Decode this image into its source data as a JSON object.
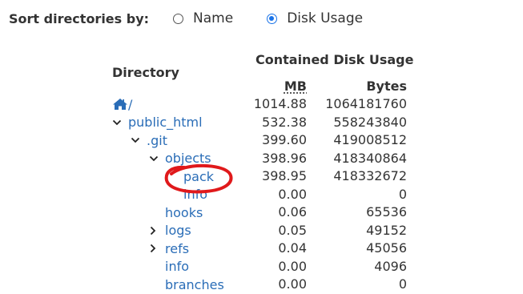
{
  "sort": {
    "label": "Sort directories by:",
    "options": [
      {
        "label": "Name",
        "checked": false
      },
      {
        "label": "Disk Usage",
        "checked": true
      }
    ]
  },
  "table": {
    "directory_header": "Directory",
    "contained_header": "Contained Disk Usage",
    "mb_header": "MB",
    "bytes_header": "Bytes",
    "rows": [
      {
        "name": "/",
        "mb": "1014.88",
        "bytes": "1064181760",
        "level": 0,
        "toggle": "home"
      },
      {
        "name": "public_html",
        "mb": "532.38",
        "bytes": "558243840",
        "level": 0,
        "toggle": "expanded"
      },
      {
        "name": ".git",
        "mb": "399.60",
        "bytes": "419008512",
        "level": 1,
        "toggle": "expanded"
      },
      {
        "name": "objects",
        "mb": "398.96",
        "bytes": "418340864",
        "level": 2,
        "toggle": "expanded"
      },
      {
        "name": "pack",
        "mb": "398.95",
        "bytes": "418332672",
        "level": 3,
        "toggle": "none"
      },
      {
        "name": "info",
        "mb": "0.00",
        "bytes": "0",
        "level": 3,
        "toggle": "none"
      },
      {
        "name": "hooks",
        "mb": "0.06",
        "bytes": "65536",
        "level": 2,
        "toggle": "none"
      },
      {
        "name": "logs",
        "mb": "0.05",
        "bytes": "49152",
        "level": 2,
        "toggle": "collapsed"
      },
      {
        "name": "refs",
        "mb": "0.04",
        "bytes": "45056",
        "level": 2,
        "toggle": "collapsed"
      },
      {
        "name": "info",
        "mb": "0.00",
        "bytes": "4096",
        "level": 2,
        "toggle": "none"
      },
      {
        "name": "branches",
        "mb": "0.00",
        "bytes": "0",
        "level": 2,
        "toggle": "none"
      }
    ]
  },
  "colors": {
    "link": "#2a6db7",
    "text": "#333333",
    "radio_accent": "#1a73e8",
    "annotation": "#e0191b"
  },
  "icons": {
    "home": "home-icon",
    "expanded": "chevron-down-icon",
    "collapsed": "chevron-right-icon"
  }
}
